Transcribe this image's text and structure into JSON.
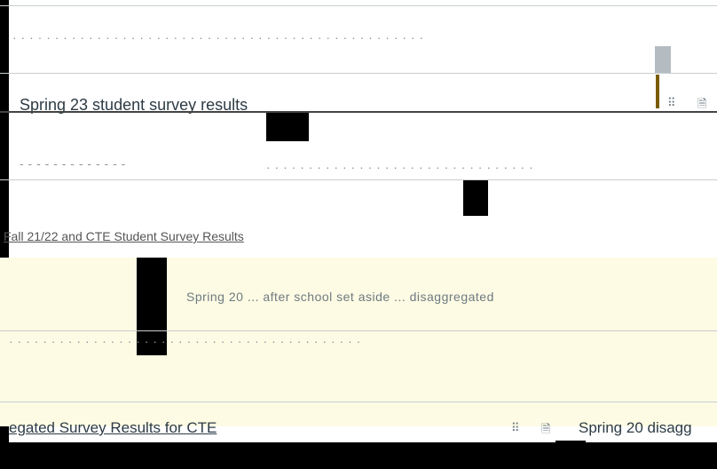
{
  "rows": [
    {
      "text": "Spring 23 student survey results"
    },
    {
      "text": "Fall 21/22 and CTE Student Survey Results"
    },
    {
      "text": "Spring 20 ... after school set aside ... disaggregated"
    },
    {
      "text": "egated Survey Results for CTE"
    },
    {
      "text": "Spring 20 disagg"
    }
  ],
  "icons": {
    "drag_handle": "drag-handle-icon",
    "page": "page-icon"
  },
  "colors": {
    "highlight": "#fdfbe3",
    "border": "#c7cdd1",
    "text": "#2d3b45"
  }
}
